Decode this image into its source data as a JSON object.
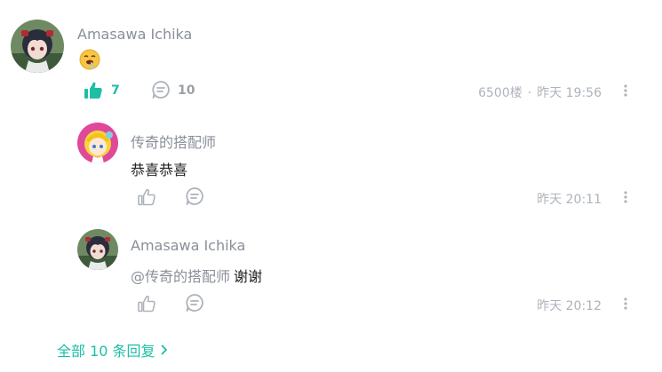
{
  "main_comment": {
    "username": "Amasawa Ichika",
    "emoji_icon": "drooling-face-emoji",
    "like_count": "7",
    "reply_count": "10",
    "floor": "6500楼",
    "separator": "·",
    "time": "昨天 19:56",
    "liked": true
  },
  "replies": [
    {
      "username": "传奇的搭配师",
      "text": "恭喜恭喜",
      "time": "昨天 20:11"
    },
    {
      "username": "Amasawa Ichika",
      "mention": "@传奇的搭配师",
      "text": "谢谢",
      "time": "昨天 20:12"
    }
  ],
  "footer": {
    "all_replies": "全部 10 条回复"
  },
  "colors": {
    "accent": "#1bbfa5",
    "muted": "#aeb3bb",
    "text": "#222222",
    "username": "#8a8f99"
  }
}
